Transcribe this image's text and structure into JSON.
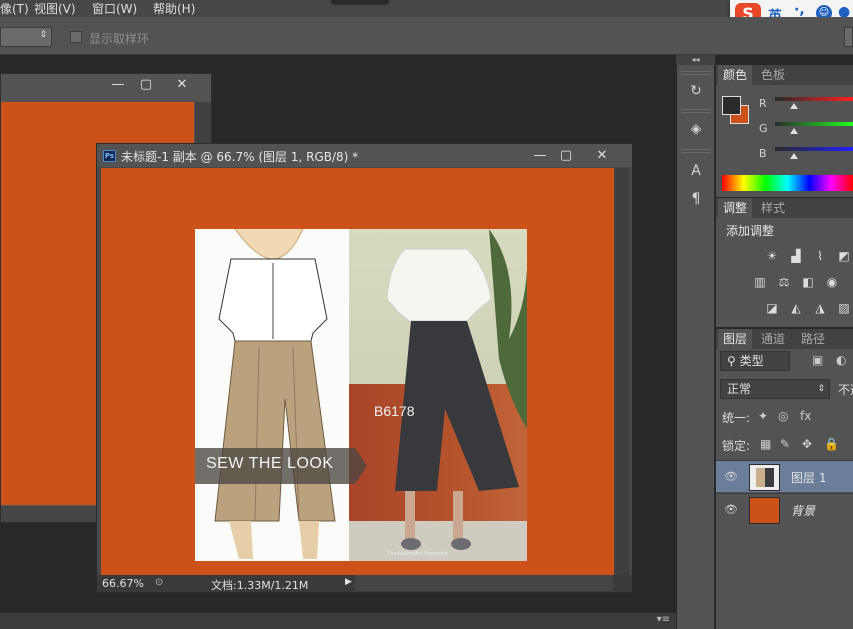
{
  "menu": {
    "items": [
      "像(T)",
      "视图(V)",
      "窗口(W)",
      "帮助(H)"
    ]
  },
  "ime": {
    "logo": "S",
    "mode": "英",
    "punct": "·,",
    "icons": [
      "emoji-icon",
      "mic-icon",
      "keyboard-icon"
    ]
  },
  "options": {
    "show_ring_label": "显示取样环"
  },
  "doc2": {
    "title": "未标题-1 副本 @ 66.7% (图层 1, RGB/8) *",
    "ps_badge": "Ps",
    "zoom": "66.67%",
    "doc_size": "文档:1.33M/1.21M",
    "artwork": {
      "banner": "SEW THE LOOK",
      "pattern_code": "B6178",
      "credit": "The Minimalist Wardrobe"
    }
  },
  "color_panel": {
    "tabs": [
      "颜色",
      "色板"
    ],
    "channels": [
      "R",
      "G",
      "B"
    ],
    "fg_color": "#2a2a2a",
    "bg_color": "#cd5219"
  },
  "adjust_panel": {
    "tabs": [
      "调整",
      "样式"
    ],
    "heading": "添加调整"
  },
  "layers_panel": {
    "tabs": [
      "图层",
      "通道",
      "路径"
    ],
    "filter_type": "类型",
    "blend_mode": "正常",
    "opacity_label": "不透",
    "unify_label": "统一:",
    "lock_label": "锁定:",
    "layers": [
      {
        "name": "图层 1",
        "selected": true
      },
      {
        "name": "背景",
        "selected": false
      }
    ]
  },
  "colors": {
    "canvas_orange": "#cd5219",
    "panel_bg": "#535353",
    "app_bg": "#282828"
  }
}
